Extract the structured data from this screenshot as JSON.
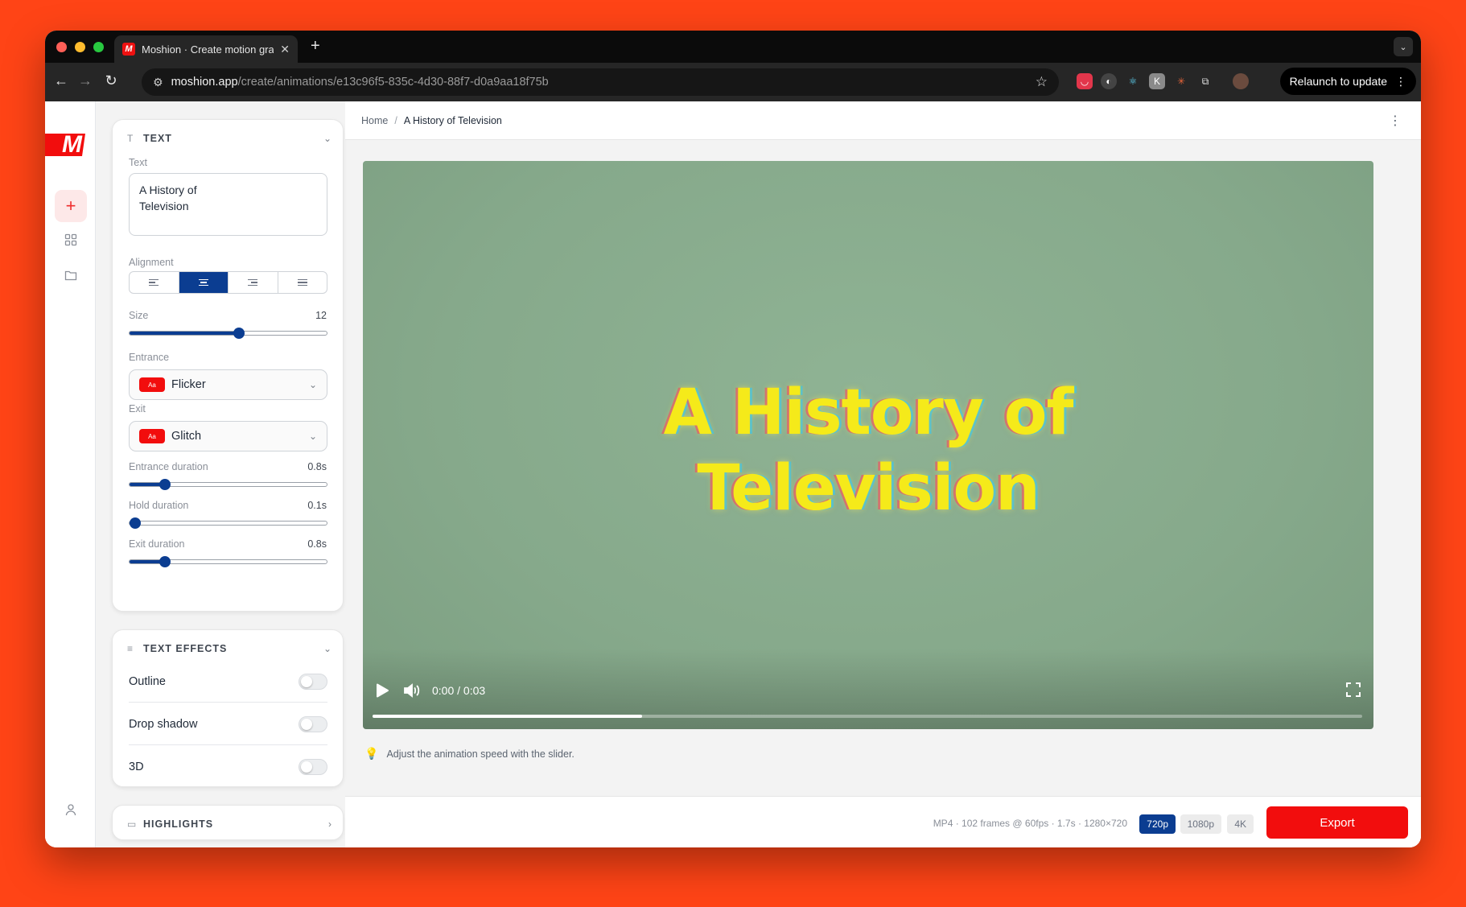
{
  "browser": {
    "tab_title": "Moshion · Create motion graphics",
    "favicon": "M",
    "new_tab": "+",
    "url_host": "moshion.app",
    "url_path": "/create/animations/e13c96f5-835c-4d30-88f7-d0a9aa18f75b",
    "relaunch_label": "Relaunch to update"
  },
  "app": {
    "logo": "M",
    "rail": [
      "plus-icon",
      "grid-icon",
      "folder-icon",
      "user-icon"
    ]
  },
  "text_panel": {
    "title": "TEXT",
    "text_label": "Text",
    "text_value": "A History of\nTelevision",
    "alignment_label": "Alignment",
    "alignment_selected": "center",
    "size_label": "Size",
    "size_value": "12",
    "size_fraction": 0.555,
    "entrance_label": "Entrance",
    "entrance_value": "Flicker",
    "exit_label": "Exit",
    "exit_value": "Glitch",
    "chip_text": "Aa",
    "entrance_duration_label": "Entrance duration",
    "entrance_duration_value": "0.8s",
    "entrance_duration_fraction": 0.18,
    "hold_duration_label": "Hold duration",
    "hold_duration_value": "0.1s",
    "hold_duration_fraction": 0.03,
    "exit_duration_label": "Exit duration",
    "exit_duration_value": "0.8s",
    "exit_duration_fraction": 0.18
  },
  "effects_panel": {
    "title": "TEXT EFFECTS",
    "toggles": [
      {
        "label": "Outline",
        "on": false
      },
      {
        "label": "Drop shadow",
        "on": false
      },
      {
        "label": "3D",
        "on": false
      }
    ]
  },
  "highlights_panel": {
    "title": "HIGHLIGHTS"
  },
  "breadcrumb": {
    "home": "Home",
    "separator": "/",
    "current": "A History of Television"
  },
  "video": {
    "title_text": "A History of\nTelevision",
    "time": "0:00 / 0:03",
    "progress_fraction": 0.272,
    "title_color": "#f5ea1a"
  },
  "hint": "Adjust the animation speed with the slider.",
  "export_bar": {
    "meta": "MP4 · 102 frames @ 60fps · 1.7s · 1280×720",
    "resolutions": [
      "720p",
      "1080p",
      "4K"
    ],
    "active_resolution": "720p",
    "export_label": "Export",
    "accent": "#f20d0d",
    "primary": "#0b3d91"
  }
}
